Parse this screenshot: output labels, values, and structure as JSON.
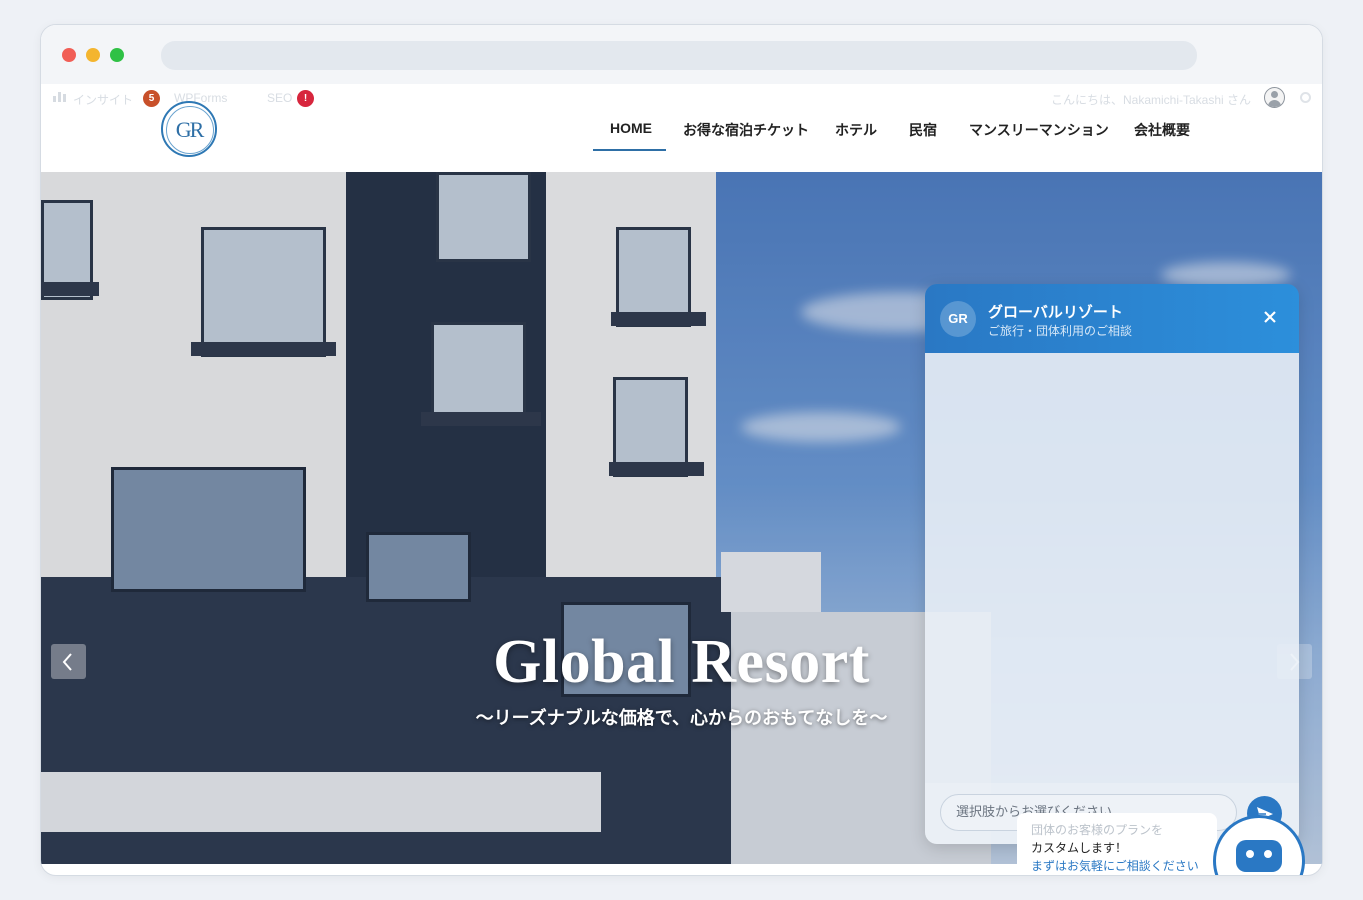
{
  "admin_bar": {
    "insight_label": "インサイト",
    "insight_count": "5",
    "wpforms_label": "WPForms",
    "seo_label": "SEO",
    "seo_alert": "!",
    "greeting": "こんにちは、Nakamichi-Takashi さん"
  },
  "logo": {
    "text": "GR"
  },
  "nav": {
    "items": [
      {
        "label": "HOME"
      },
      {
        "label": "お得な宿泊チケット"
      },
      {
        "label": "ホテル"
      },
      {
        "label": "民宿"
      },
      {
        "label": "マンスリーマンション"
      },
      {
        "label": "会社概要"
      }
    ],
    "active_index": 0
  },
  "hero": {
    "title": "Global Resort",
    "subtitle": "〜リーズナブルな価格で、心からのおもてなしを〜"
  },
  "chat": {
    "avatar": "GR",
    "title": "グローバルリゾート",
    "subtitle": "ご旅行・団体利用のご相談",
    "input_placeholder": "選択肢からお選びください"
  },
  "promo": {
    "line1": "団体のお客様のプランを",
    "line2": "カスタムします！",
    "line3": "まずはお気軽にご相談ください"
  },
  "colors": {
    "accent": "#2a78c4",
    "nav_underline": "#2e6fa6",
    "badge_orange": "#c8502a",
    "badge_red": "#d7263d"
  }
}
